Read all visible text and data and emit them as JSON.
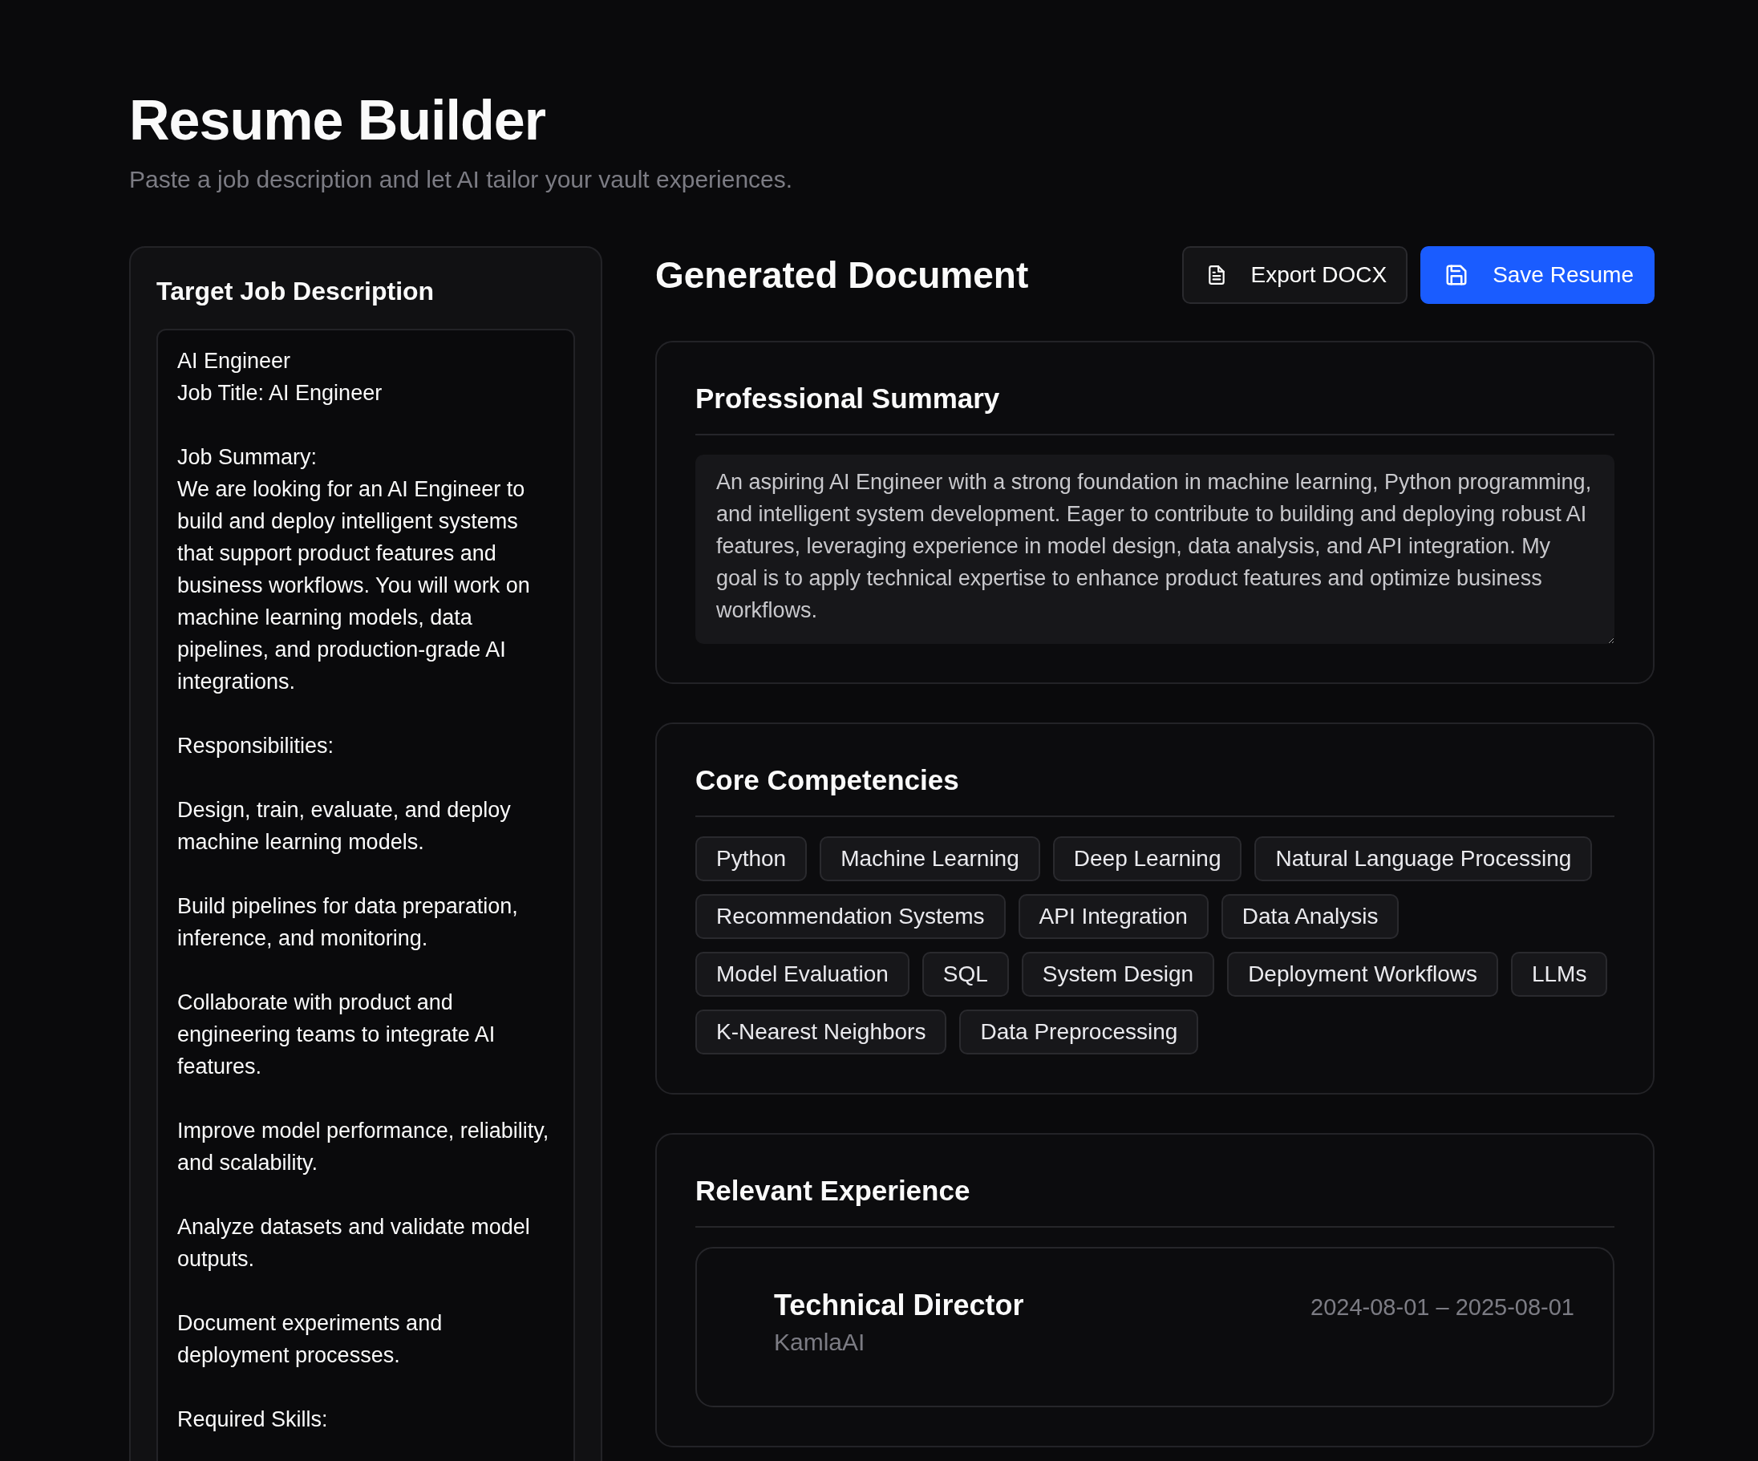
{
  "header": {
    "title": "Resume Builder",
    "subtitle": "Paste a job description and let AI tailor your vault experiences."
  },
  "job_panel": {
    "title": "Target Job Description",
    "description": "AI Engineer\nJob Title: AI Engineer\n\nJob Summary:\nWe are looking for an AI Engineer to build and deploy intelligent systems that support product features and business workflows. You will work on machine learning models, data pipelines, and production-grade AI integrations.\n\nResponsibilities:\n\nDesign, train, evaluate, and deploy machine learning models.\n\nBuild pipelines for data preparation, inference, and monitoring.\n\nCollaborate with product and engineering teams to integrate AI features.\n\nImprove model performance, reliability, and scalability.\n\nAnalyze datasets and validate model outputs.\n\nDocument experiments and deployment processes.\n\nRequired Skills:"
  },
  "document": {
    "title": "Generated Document",
    "actions": [
      {
        "kind": "secondary",
        "label": "Export DOCX"
      },
      {
        "kind": "primary",
        "label": "Save Resume"
      }
    ],
    "summary": {
      "title": "Professional Summary",
      "text": "An aspiring AI Engineer with a strong foundation in machine learning, Python programming, and intelligent system development. Eager to contribute to building and deploying robust AI features, leveraging experience in model design, data analysis, and API integration. My goal is to apply technical expertise to enhance product features and optimize business workflows."
    },
    "competencies": {
      "title": "Core Competencies",
      "tags": [
        "Python",
        "Machine Learning",
        "Deep Learning",
        "Natural Language Processing",
        "Recommendation Systems",
        "API Integration",
        "Data Analysis",
        "Model Evaluation",
        "SQL",
        "System Design",
        "Deployment Workflows",
        "LLMs",
        "K-Nearest Neighbors",
        "Data Preprocessing"
      ]
    },
    "experience": {
      "title": "Relevant Experience",
      "items": [
        {
          "role": "Technical Director",
          "dates": "2024-08-01 – 2025-08-01",
          "company": "KamlaAI"
        }
      ]
    }
  }
}
